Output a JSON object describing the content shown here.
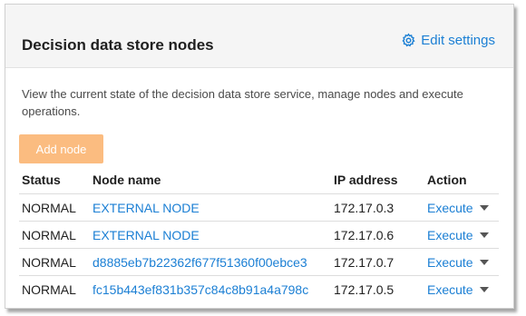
{
  "card": {
    "title": "Decision data store nodes",
    "edit_settings_label": "Edit settings",
    "description": "View the current state of the decision data store service, manage nodes and execute operations.",
    "add_node_label": "Add node"
  },
  "table": {
    "headers": {
      "status": "Status",
      "node_name": "Node name",
      "ip_address": "IP address",
      "action": "Action"
    },
    "rows": [
      {
        "status": "NORMAL",
        "node_name": "EXTERNAL NODE",
        "ip": "172.17.0.3",
        "action": "Execute"
      },
      {
        "status": "NORMAL",
        "node_name": "EXTERNAL NODE",
        "ip": "172.17.0.6",
        "action": "Execute"
      },
      {
        "status": "NORMAL",
        "node_name": "d8885eb7b22362f677f51360f00ebce3",
        "ip": "172.17.0.7",
        "action": "Execute"
      },
      {
        "status": "NORMAL",
        "node_name": "fc15b443ef831b357c84c8b91a4a798c",
        "ip": "172.17.0.5",
        "action": "Execute"
      }
    ]
  },
  "colors": {
    "link": "#1b7fd4",
    "add_node_button": "#fbb16b",
    "header_bg": "#f5f5f5"
  },
  "icons": {
    "edit_settings": "gear-icon",
    "execute_dropdown": "caret-down-icon"
  }
}
